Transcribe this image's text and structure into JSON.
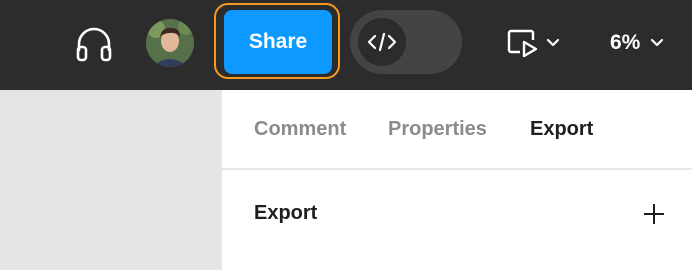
{
  "toolbar": {
    "icons": [
      "headphones-icon",
      "avatar",
      "code-icon",
      "present-icon",
      "chevron-down-icon"
    ],
    "share_label": "Share",
    "zoom_label": "6%"
  },
  "panel": {
    "tabs": [
      {
        "label": "Comment",
        "active": false
      },
      {
        "label": "Properties",
        "active": false
      },
      {
        "label": "Export",
        "active": true
      }
    ],
    "section": {
      "title": "Export"
    }
  },
  "colors": {
    "toolbar_bg": "#2c2c2c",
    "share_bg": "#0d99ff",
    "focus_ring": "#f59a1f",
    "canvas_bg": "#e5e5e5"
  }
}
